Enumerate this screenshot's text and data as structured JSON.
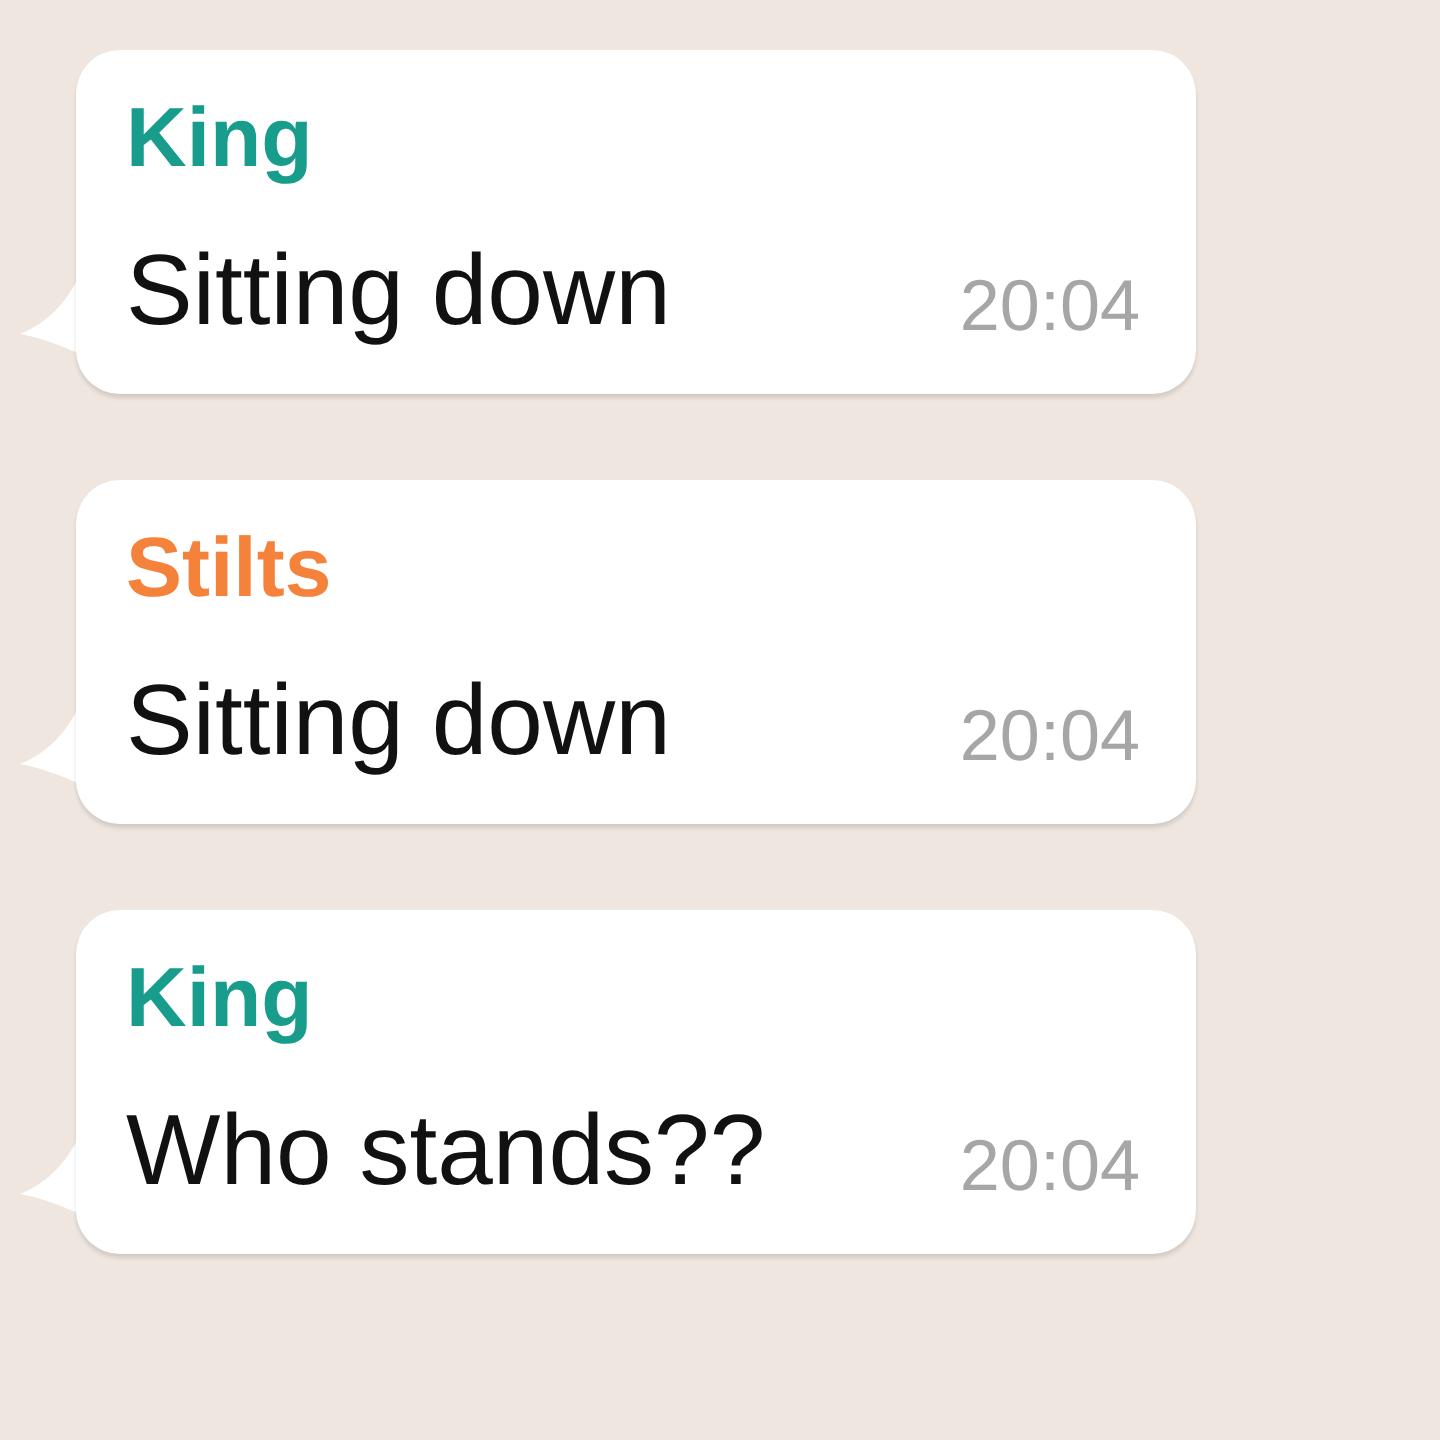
{
  "messages": [
    {
      "sender": "King",
      "color": "#189c8c",
      "text": "Sitting down",
      "time": "20:04"
    },
    {
      "sender": "Stilts",
      "color": "#f5823a",
      "text": "Sitting down",
      "time": "20:04"
    },
    {
      "sender": "King",
      "color": "#189c8c",
      "text": "Who stands??",
      "time": "20:04"
    }
  ]
}
